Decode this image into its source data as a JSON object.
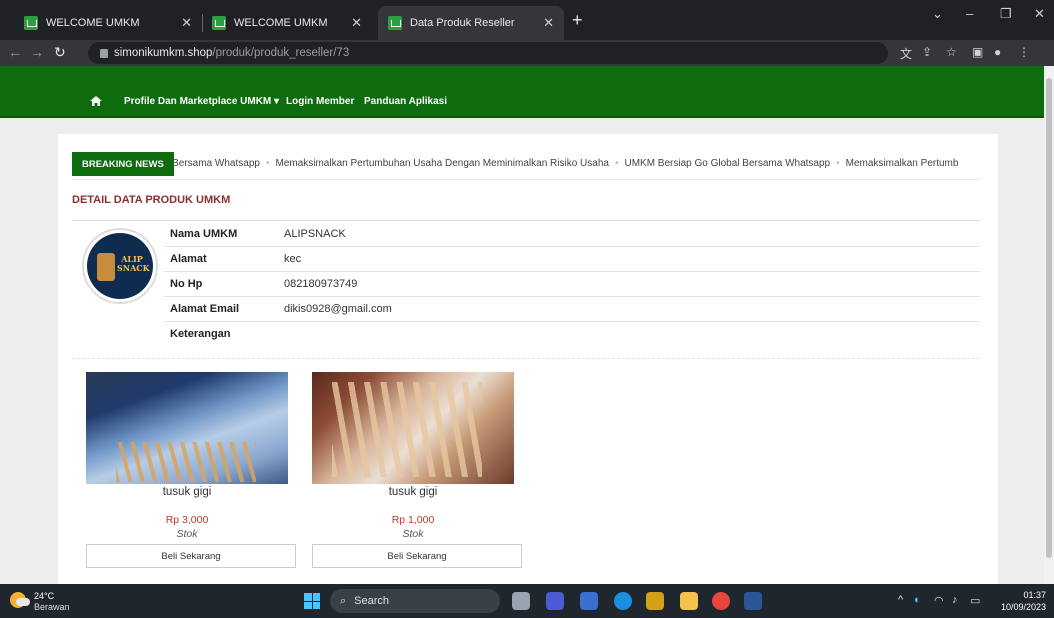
{
  "browser": {
    "tabs": [
      {
        "title": "WELCOME UMKM",
        "active": false
      },
      {
        "title": "WELCOME UMKM",
        "active": false
      },
      {
        "title": "Data Produk Reseller",
        "active": true
      }
    ],
    "url_host": "simonikumkm.shop",
    "url_path": "/produk/produk_reseller/73"
  },
  "nav": {
    "items": [
      "Profile Dan Marketplace UMKM ▾",
      "Login Member",
      "Panduan Aplikasi"
    ]
  },
  "breaking": {
    "label": "BREAKING NEWS",
    "headlines": [
      "bal Bersama Whatsapp",
      "Memaksimalkan Pertumbuhan Usaha Dengan Meminimalkan Risiko Usaha",
      "UMKM Bersiap Go Global Bersama Whatsapp",
      "Memaksimalkan Pertumb"
    ]
  },
  "detail": {
    "title": "DETAIL DATA PRODUK UMKM",
    "logo_text": "ALIP SNACK",
    "rows": [
      {
        "key": "Nama UMKM",
        "value": "ALIPSNACK"
      },
      {
        "key": "Alamat",
        "value": "kec"
      },
      {
        "key": "No Hp",
        "value": "082180973749"
      },
      {
        "key": "Alamat Email",
        "value": "dikis0928@gmail.com"
      },
      {
        "key": "Keterangan",
        "value": ""
      }
    ]
  },
  "products": [
    {
      "name": "tusuk gigi",
      "price": "Rp 3,000",
      "stock": "Stok",
      "button": "Beli Sekarang"
    },
    {
      "name": "tusuk gigi",
      "price": "Rp 1,000",
      "stock": "Stok",
      "button": "Beli Sekarang"
    }
  ],
  "taskbar": {
    "temp": "24°C",
    "weather": "Berawan",
    "search": "Search",
    "time": "01:37",
    "date": "10/09/2023"
  },
  "colors": {
    "nav_green": "#0e6b0e",
    "section_title": "#8b2f2f",
    "price_red": "#c0392b"
  }
}
